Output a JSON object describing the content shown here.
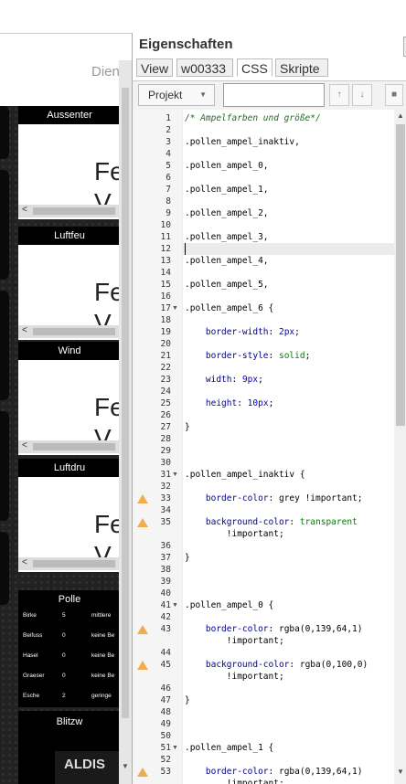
{
  "left": {
    "partial_title": "Dien",
    "widgets": [
      {
        "title": "Aussenter",
        "value_line1": "Fe",
        "value_line2": "V"
      },
      {
        "title": "Luftfeu",
        "value_line1": "Fe",
        "value_line2": "V"
      },
      {
        "title": "Wind",
        "value_line1": "Fe",
        "value_line2": "V"
      },
      {
        "title": "Luftdru",
        "value_line1": "Fe",
        "value_line2": "V"
      }
    ],
    "pollen": {
      "title": "Polle",
      "rows": [
        {
          "name": "Birke",
          "level": "5",
          "desc": "mittlere"
        },
        {
          "name": "Beifuss",
          "level": "0",
          "desc": "keine Be"
        },
        {
          "name": "Hasel",
          "level": "0",
          "desc": "keine Be"
        },
        {
          "name": "Graeser",
          "level": "0",
          "desc": "keine Be"
        },
        {
          "name": "Esche",
          "level": "2",
          "desc": "geringe"
        }
      ]
    },
    "blitz": {
      "title": "Blitzw",
      "logo": "ALDIS"
    }
  },
  "panel": {
    "title": "Eigenschaften",
    "tabs": [
      {
        "label": "View",
        "active": false
      },
      {
        "label": "w00333",
        "active": false
      },
      {
        "label": "CSS",
        "active": true
      },
      {
        "label": "Skripte",
        "active": false
      }
    ],
    "project_select": "Projekt",
    "search_value": ""
  },
  "editor": {
    "current_line": 12,
    "lines": [
      {
        "n": "1",
        "text": "/* Ampelfarben und größe*/",
        "kind": "comment"
      },
      {
        "n": "2",
        "text": ""
      },
      {
        "n": "3",
        "text": ".pollen_ampel_inaktiv,",
        "kind": "sel"
      },
      {
        "n": "4",
        "text": ""
      },
      {
        "n": "5",
        "text": ".pollen_ampel_0,",
        "kind": "sel"
      },
      {
        "n": "6",
        "text": ""
      },
      {
        "n": "7",
        "text": ".pollen_ampel_1,",
        "kind": "sel"
      },
      {
        "n": "8",
        "text": ""
      },
      {
        "n": "9",
        "text": ".pollen_ampel_2,",
        "kind": "sel"
      },
      {
        "n": "10",
        "text": ""
      },
      {
        "n": "11",
        "text": ".pollen_ampel_3,",
        "kind": "sel"
      },
      {
        "n": "12",
        "text": ""
      },
      {
        "n": "13",
        "text": ".pollen_ampel_4,",
        "kind": "sel"
      },
      {
        "n": "14",
        "text": ""
      },
      {
        "n": "15",
        "text": ".pollen_ampel_5,",
        "kind": "sel"
      },
      {
        "n": "16",
        "text": ""
      },
      {
        "n": "17",
        "text": ".pollen_ampel_6 {",
        "kind": "sel",
        "fold": true
      },
      {
        "n": "18",
        "text": ""
      },
      {
        "n": "19",
        "prop": "border-width",
        "val": "2px",
        "vkind": "num"
      },
      {
        "n": "20",
        "text": ""
      },
      {
        "n": "21",
        "prop": "border-style",
        "val": "solid",
        "vkind": "green"
      },
      {
        "n": "22",
        "text": ""
      },
      {
        "n": "23",
        "prop": "width",
        "val": "9px",
        "vkind": "num"
      },
      {
        "n": "24",
        "text": ""
      },
      {
        "n": "25",
        "prop": "height",
        "val": "10px",
        "vkind": "num"
      },
      {
        "n": "26",
        "text": ""
      },
      {
        "n": "27",
        "text": "}",
        "kind": "sel"
      },
      {
        "n": "28",
        "text": ""
      },
      {
        "n": "29",
        "text": ""
      },
      {
        "n": "30",
        "text": ""
      },
      {
        "n": "31",
        "text": ".pollen_ampel_inaktiv {",
        "kind": "sel",
        "fold": true
      },
      {
        "n": "32",
        "text": ""
      },
      {
        "n": "33",
        "prop": "border-color",
        "val": "grey !important",
        "vkind": "plain",
        "warn": true
      },
      {
        "n": "34",
        "text": ""
      },
      {
        "n": "35",
        "prop": "background-color",
        "val": "transparent",
        "vkind": "green",
        "warn": true,
        "wrap": "!important"
      },
      {
        "n": "36",
        "text": ""
      },
      {
        "n": "37",
        "text": "}",
        "kind": "sel"
      },
      {
        "n": "38",
        "text": ""
      },
      {
        "n": "39",
        "text": ""
      },
      {
        "n": "40",
        "text": ""
      },
      {
        "n": "41",
        "text": ".pollen_ampel_0 {",
        "kind": "sel",
        "fold": true
      },
      {
        "n": "42",
        "text": ""
      },
      {
        "n": "43",
        "prop": "border-color",
        "val": "rgba(0,139,64,1)",
        "vkind": "rgba",
        "warn": true,
        "wrap": "!important"
      },
      {
        "n": "44",
        "text": ""
      },
      {
        "n": "45",
        "prop": "background-color",
        "val": "rgba(0,100,0)",
        "vkind": "rgba",
        "warn": true,
        "wrap": "!important"
      },
      {
        "n": "46",
        "text": ""
      },
      {
        "n": "47",
        "text": "}",
        "kind": "sel"
      },
      {
        "n": "48",
        "text": ""
      },
      {
        "n": "49",
        "text": ""
      },
      {
        "n": "50",
        "text": ""
      },
      {
        "n": "51",
        "text": ".pollen_ampel_1 {",
        "kind": "sel",
        "fold": true
      },
      {
        "n": "52",
        "text": ""
      },
      {
        "n": "53",
        "prop": "border-color",
        "val": "rgba(0,139,64,1)",
        "vkind": "rgba",
        "warn": true,
        "wrap": "!important"
      }
    ]
  }
}
